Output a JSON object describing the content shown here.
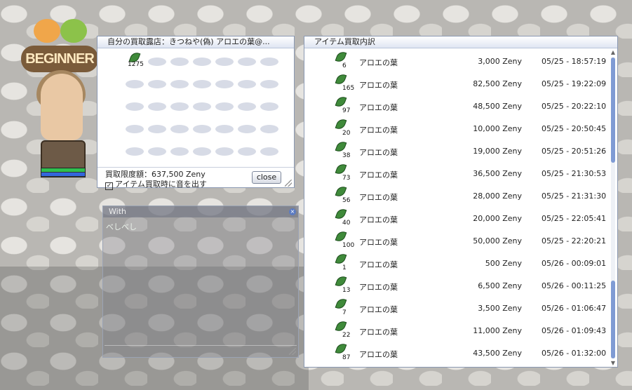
{
  "shop": {
    "title": "自分の買取露店：きつねや(偽) アロエの葉@...",
    "first_item_qty": "1275",
    "limit": "買取限度額：637,500 Zeny",
    "sound_checkbox_label": "アイテム買取時に音を出す",
    "sound_checked": true,
    "close_label": "close"
  },
  "character": {
    "logo": "BEGINNER"
  },
  "chat": {
    "title_prefix": "With",
    "line": "べしべし"
  },
  "log": {
    "title": "アイテム買取内訳",
    "rows": [
      {
        "qty": "6",
        "name": "アロエの葉",
        "amount": "3,000 Zeny",
        "time": "05/25 - 18:57:19"
      },
      {
        "qty": "165",
        "name": "アロエの葉",
        "amount": "82,500 Zeny",
        "time": "05/25 - 19:22:09"
      },
      {
        "qty": "97",
        "name": "アロエの葉",
        "amount": "48,500 Zeny",
        "time": "05/25 - 20:22:10"
      },
      {
        "qty": "20",
        "name": "アロエの葉",
        "amount": "10,000 Zeny",
        "time": "05/25 - 20:50:45"
      },
      {
        "qty": "38",
        "name": "アロエの葉",
        "amount": "19,000 Zeny",
        "time": "05/25 - 20:51:26"
      },
      {
        "qty": "73",
        "name": "アロエの葉",
        "amount": "36,500 Zeny",
        "time": "05/25 - 21:30:53"
      },
      {
        "qty": "56",
        "name": "アロエの葉",
        "amount": "28,000 Zeny",
        "time": "05/25 - 21:31:30"
      },
      {
        "qty": "40",
        "name": "アロエの葉",
        "amount": "20,000 Zeny",
        "time": "05/25 - 22:05:41"
      },
      {
        "qty": "100",
        "name": "アロエの葉",
        "amount": "50,000 Zeny",
        "time": "05/25 - 22:20:21"
      },
      {
        "qty": "1",
        "name": "アロエの葉",
        "amount": "500 Zeny",
        "time": "05/26 - 00:09:01"
      },
      {
        "qty": "13",
        "name": "アロエの葉",
        "amount": "6,500 Zeny",
        "time": "05/26 - 00:11:25"
      },
      {
        "qty": "7",
        "name": "アロエの葉",
        "amount": "3,500 Zeny",
        "time": "05/26 - 01:06:47"
      },
      {
        "qty": "22",
        "name": "アロエの葉",
        "amount": "11,000 Zeny",
        "time": "05/26 - 01:09:43"
      },
      {
        "qty": "87",
        "name": "アロエの葉",
        "amount": "43,500 Zeny",
        "time": "05/26 - 01:32:00"
      }
    ]
  },
  "colors": {
    "title_gradient_top": "#ffffff",
    "title_gradient_bottom": "#dfe5f2",
    "scroll_thumb": "#7f9bd4",
    "leaf_icon": "#3f8a3a"
  }
}
